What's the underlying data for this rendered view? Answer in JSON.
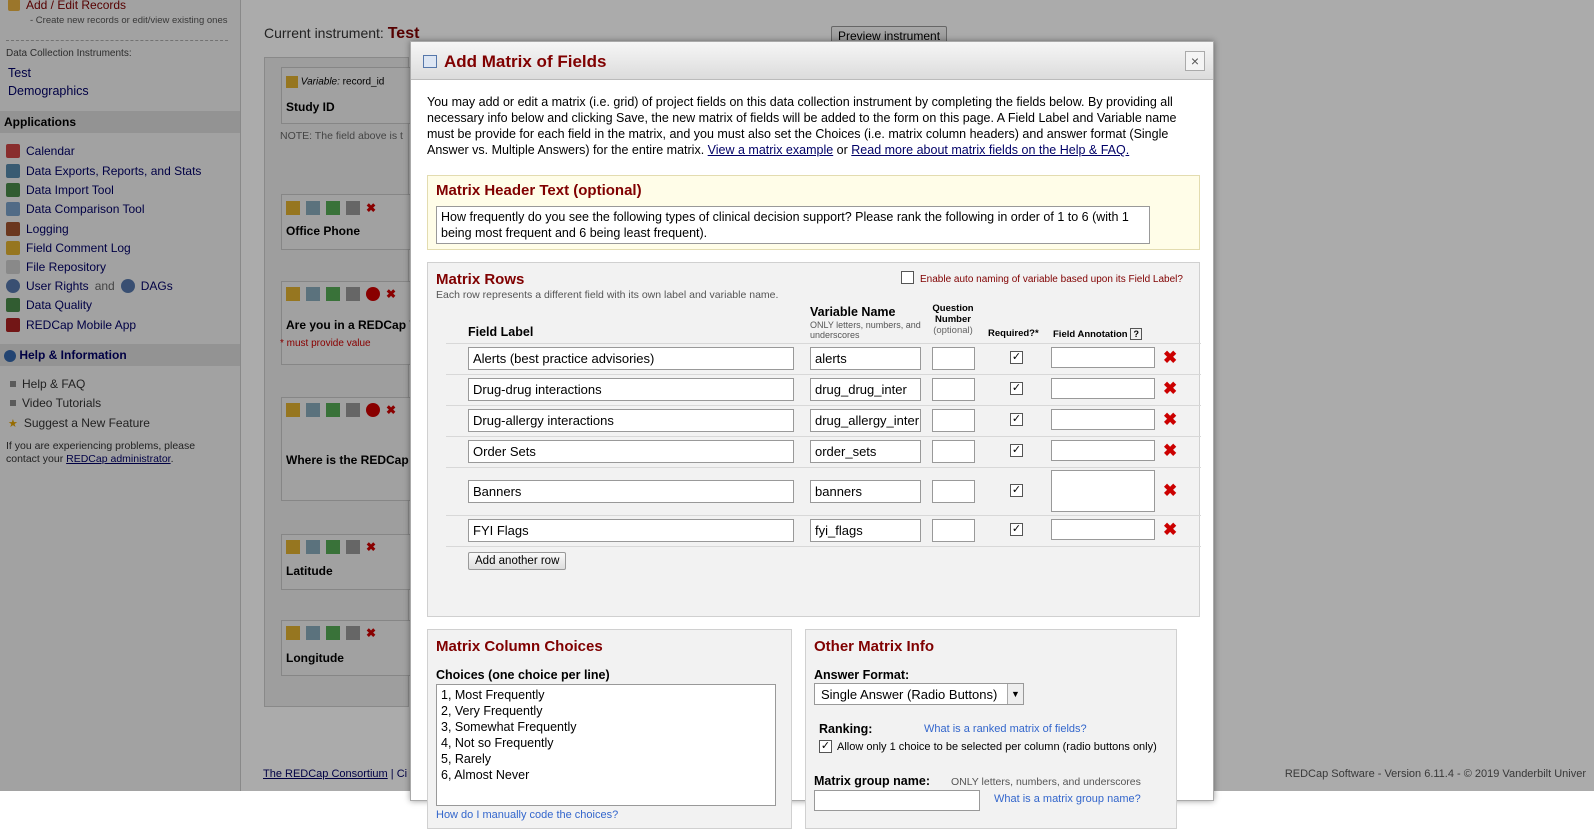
{
  "sidebar": {
    "add_edit_records": "Add / Edit Records",
    "add_edit_sub": "- Create new records or edit/view existing ones",
    "instruments_label": "Data Collection Instruments:",
    "instruments": [
      "Test",
      "Demographics"
    ],
    "applications_header": "Applications",
    "apps": [
      {
        "label": "Calendar",
        "icon": "calendar-icon"
      },
      {
        "label": "Data Exports, Reports, and Stats",
        "icon": "export-icon"
      },
      {
        "label": "Data Import Tool",
        "icon": "import-icon"
      },
      {
        "label": "Data Comparison Tool",
        "icon": "compare-icon"
      },
      {
        "label": "Logging",
        "icon": "logging-icon"
      },
      {
        "label": "Field Comment Log",
        "icon": "comment-icon"
      },
      {
        "label": "File Repository",
        "icon": "file-icon"
      },
      {
        "label": "User Rights",
        "icon": "user-icon"
      },
      {
        "label": "Data Quality",
        "icon": "quality-icon"
      },
      {
        "label": "REDCap Mobile App",
        "icon": "mobile-icon"
      }
    ],
    "and_text": "and",
    "dags_label": "DAGs",
    "help_header": "Help & Information",
    "help_items": [
      "Help & FAQ",
      "Video Tutorials",
      "Suggest a New Feature"
    ],
    "problems_text": "If you are experiencing problems, please contact your",
    "admin_link": "REDCap administrator",
    "period": "."
  },
  "main": {
    "current_instrument_label": "Current instrument:",
    "current_instrument": "Test",
    "preview_button": "Preview instrument",
    "variable_label": "Variable:",
    "variable_value": "record_id",
    "field_labels": [
      "Study ID",
      "Office Phone",
      "Are you in a REDCap V",
      "Where is the REDCap",
      "Latitude",
      "Longitude"
    ],
    "note_text": "NOTE: The field above is t",
    "must_provide": "* must provide value",
    "footer_left": "The REDCap Consortium",
    "footer_sep": "| Ci",
    "footer_right": "REDCap Software - Version 6.11.4 - © 2019 Vanderbilt Univer"
  },
  "dialog": {
    "title": "Add Matrix of Fields",
    "close": "×",
    "intro": "You may add or edit a matrix (i.e. grid) of project fields on this data collection instrument by completing the fields below. By providing all necessary info below and clicking Save, the new matrix of fields will be added to the form on this page. A Field Label and Variable name must be provide for each field in the matrix, and you must also set the Choices (i.e. matrix column headers) and answer format (Single Answer vs. Multiple Answers) for the entire matrix.",
    "view_example_link": "View a matrix example",
    "or_text": "or",
    "read_more_link": "Read more about matrix fields on the Help & FAQ.",
    "header_text_title": "Matrix Header Text (optional)",
    "header_text_value": "How frequently do you see the following types of clinical decision support? Please rank the following in order of 1 to 6 (with 1 being most frequent and 6 being least frequent).",
    "rows_title": "Matrix Rows",
    "rows_sub": "Each row represents a different field with its own label and variable name.",
    "auto_naming": "Enable auto naming of variable based upon its Field Label?",
    "col_field_label": "Field Label",
    "col_variable_name": "Variable Name",
    "col_variable_hint": "ONLY letters, numbers, and underscores",
    "col_question": "Question Number",
    "col_question_hint": "(optional)",
    "col_required": "Required?*",
    "col_annotation": "Field Annotation",
    "annotation_help": "?",
    "rows": [
      {
        "label": "Alerts (best practice advisories)",
        "variable": "alerts",
        "required": true
      },
      {
        "label": " Drug-drug interactions",
        "variable": "drug_drug_inter",
        "required": true
      },
      {
        "label": " Drug-allergy interactions",
        "variable": "drug_allergy_inter",
        "required": true
      },
      {
        "label": "Order Sets",
        "variable": "order_sets",
        "required": true
      },
      {
        "label": "Banners",
        "variable": "banners",
        "required": true
      },
      {
        "label": "FYI Flags",
        "variable": "fyi_flags",
        "required": true
      }
    ],
    "add_row_button": "Add another row",
    "choices_title": "Matrix Column Choices",
    "choices_label": "Choices (one choice per line)",
    "choices": [
      "1, Most Frequently",
      "2, Very Frequently",
      "3, Somewhat Frequently",
      "4, Not so Frequently",
      "5, Rarely",
      "6, Almost Never"
    ],
    "manual_code_link": "How do I manually code the choices?",
    "other_title": "Other Matrix Info",
    "answer_format_label": "Answer Format:",
    "answer_format_value": "Single Answer (Radio Buttons)",
    "ranking_label": "Ranking:",
    "ranking_link": "What is a ranked matrix of fields?",
    "ranking_option": "Allow only 1 choice to be selected per column (radio buttons only)",
    "group_name_label": "Matrix group name:",
    "group_name_hint": "ONLY letters, numbers, and underscores",
    "group_name_link": "What is a matrix group name?"
  }
}
